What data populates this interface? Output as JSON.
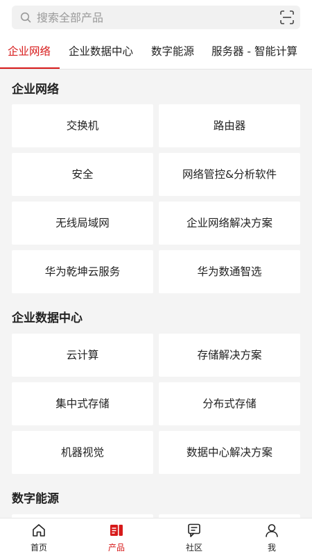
{
  "search": {
    "placeholder": "搜索全部产品"
  },
  "tabs": [
    {
      "label": "企业网络",
      "active": true
    },
    {
      "label": "企业数据中心"
    },
    {
      "label": "数字能源"
    },
    {
      "label": "服务器 - 智能计算"
    }
  ],
  "sections": [
    {
      "title": "企业网络",
      "items": [
        "交换机",
        "路由器",
        "安全",
        "网络管控&分析软件",
        "无线局域网",
        "企业网络解决方案",
        "华为乾坤云服务",
        "华为数通智选"
      ]
    },
    {
      "title": "企业数据中心",
      "items": [
        "云计算",
        "存储解决方案",
        "集中式存储",
        "分布式存储",
        "机器视觉",
        "数据中心解决方案"
      ]
    },
    {
      "title": "数字能源",
      "items": []
    }
  ],
  "bottom_nav": [
    {
      "label": "首页",
      "icon": "home-icon"
    },
    {
      "label": "产品",
      "icon": "product-icon",
      "active": true
    },
    {
      "label": "社区",
      "icon": "community-icon"
    },
    {
      "label": "我",
      "icon": "profile-icon"
    }
  ],
  "colors": {
    "accent": "#d71a1a",
    "background": "#f4f4f4",
    "card": "#ffffff"
  }
}
